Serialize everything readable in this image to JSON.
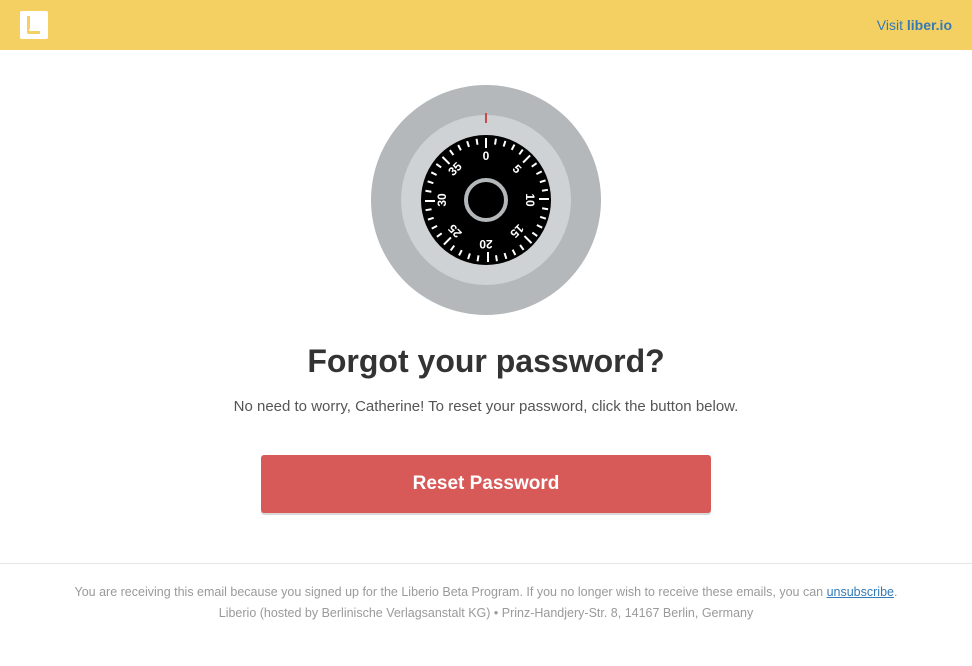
{
  "header": {
    "visit_prefix": "Visit ",
    "visit_site": "liber.io"
  },
  "dial": {
    "numbers": [
      "0",
      "5",
      "10",
      "15",
      "20",
      "25",
      "30",
      "35"
    ]
  },
  "main": {
    "heading": "Forgot your password?",
    "subtext": "No need to worry, Catherine! To reset your password, click the button below.",
    "button_label": "Reset Password"
  },
  "footer": {
    "line1_pre": "You are receiving this email because you signed up for the Liberio Beta Program. If you no longer wish to receive these emails, you can ",
    "unsubscribe": "unsubscribe",
    "line1_post": ".",
    "line2": "Liberio (hosted by Berlinische Verlagsanstalt KG) • Prinz-Handjery-Str. 8, 14167 Berlin, Germany"
  }
}
